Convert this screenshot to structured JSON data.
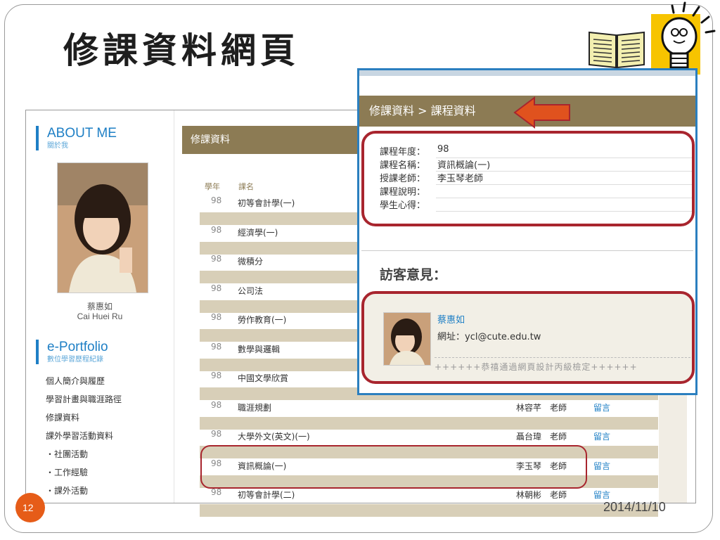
{
  "slide": {
    "title": "修課資料網頁",
    "page_number": "12",
    "date": "2014/11/10"
  },
  "sidebar": {
    "about_title": "ABOUT ME",
    "about_subtitle": "關於我",
    "name_cn": "蔡惠如",
    "name_en": "Cai Huei Ru",
    "portfolio_title": "e-Portfolio",
    "portfolio_subtitle": "數位學習歷程紀錄",
    "items": [
      {
        "label": "個人簡介與履歷"
      },
      {
        "label": "學習計畫與職涯路徑"
      },
      {
        "label": "修課資料"
      },
      {
        "label": "課外學習活動資料"
      },
      {
        "label": "・社團活動"
      },
      {
        "label": "・工作經驗"
      },
      {
        "label": "・課外活動"
      }
    ]
  },
  "content": {
    "header": "修課資料",
    "columns": {
      "year": "學年",
      "course": "課名"
    },
    "rows": [
      {
        "year": "98",
        "course": "初等會計學(一)",
        "teacher": "",
        "title": "",
        "link": ""
      },
      {
        "year": "98",
        "course": "經濟學(一)",
        "teacher": "",
        "title": "",
        "link": ""
      },
      {
        "year": "98",
        "course": "微積分",
        "teacher": "",
        "title": "",
        "link": ""
      },
      {
        "year": "98",
        "course": "公司法",
        "teacher": "",
        "title": "",
        "link": ""
      },
      {
        "year": "98",
        "course": "勞作教育(一)",
        "teacher": "",
        "title": "",
        "link": ""
      },
      {
        "year": "98",
        "course": "數學與邏輯",
        "teacher": "",
        "title": "",
        "link": ""
      },
      {
        "year": "98",
        "course": "中國文學欣賞",
        "teacher": "",
        "title": "",
        "link": ""
      },
      {
        "year": "98",
        "course": "職涯規劃",
        "teacher": "林容芊",
        "title": "老師",
        "link": "留言"
      },
      {
        "year": "98",
        "course": "大學外文(英文)(一)",
        "teacher": "聶台瑋",
        "title": "老師",
        "link": "留言"
      },
      {
        "year": "98",
        "course": "資訊概論(一)",
        "teacher": "李玉琴",
        "title": "老師",
        "link": "留言"
      },
      {
        "year": "98",
        "course": "初等會計學(二)",
        "teacher": "林朝彬",
        "title": "老師",
        "link": "留言"
      }
    ]
  },
  "detail": {
    "breadcrumb": "修課資料 > 課程資料",
    "fields": [
      {
        "label": "課程年度：",
        "value": "98"
      },
      {
        "label": "課程名稱：",
        "value": "資訊概論(一)"
      },
      {
        "label": "授課老師：",
        "value": "李玉琴老師"
      },
      {
        "label": "課程說明：",
        "value": ""
      },
      {
        "label": "學生心得：",
        "value": ""
      }
    ],
    "visitor_title": "訪客意見：",
    "comment": {
      "name": "蔡惠如",
      "url": "網址：ycl@cute.edu.tw",
      "message": "++++++恭禧通過網頁設計丙級檢定++++++"
    }
  },
  "colors": {
    "brown_bar": "#8c7b54",
    "blue_accent": "#1e7fc5",
    "highlight_red": "#a8252e",
    "arrow_orange": "#e0521e",
    "page_badge": "#e65c18"
  }
}
